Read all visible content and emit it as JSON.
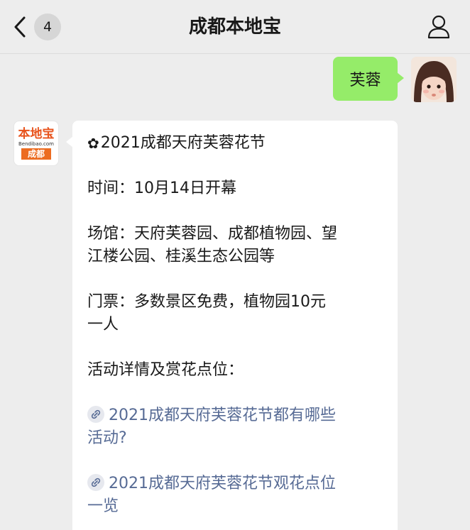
{
  "nav": {
    "unread_count": "4",
    "title": "成都本地宝"
  },
  "outgoing": {
    "text": "芙蓉"
  },
  "bot": {
    "logo_top": "本地宝",
    "logo_url": "Bendibao.com",
    "logo_city": "成都"
  },
  "message": {
    "headline": "2021成都天府芙蓉花节",
    "time_line": "时间：10月14日开幕",
    "venue_line1": "场馆：天府芙蓉园、成都植物园、望",
    "venue_line2": "江楼公园、桂溪生态公园等",
    "ticket_line1": "门票：多数景区免费，植物园10元",
    "ticket_line2": "一人",
    "details_label": "活动详情及赏花点位：",
    "link1_line1": "2021成都天府芙蓉花节都有哪些",
    "link1_line2": "活动?",
    "link2_line1": "2021成都天府芙蓉花节观花点位",
    "link2_line2": "一览"
  },
  "colors": {
    "background": "#ededed",
    "outgoing_bubble": "#95ec69",
    "link": "#576b95",
    "brand": "#e8531c"
  },
  "icons": [
    "back-chevron-icon",
    "profile-icon",
    "flower-icon",
    "link-icon"
  ]
}
